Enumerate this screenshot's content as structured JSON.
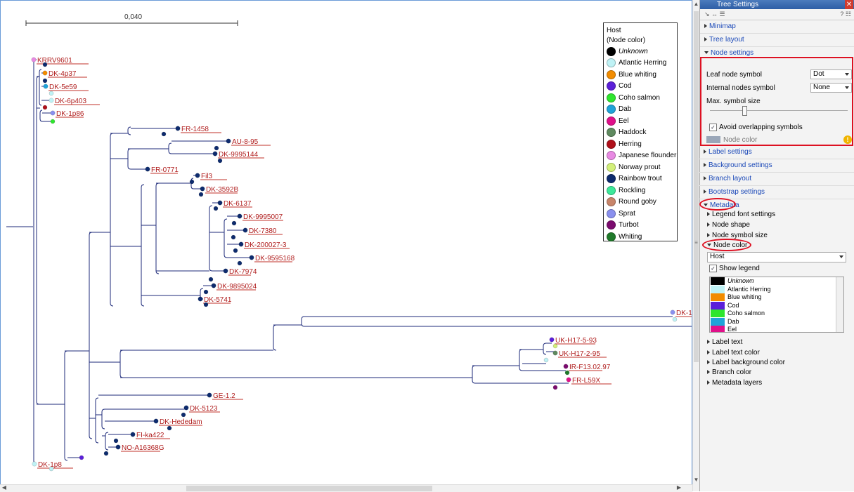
{
  "scale_bar": "0,040",
  "legend": {
    "title": "Host",
    "subtitle": "(Node color)",
    "items": [
      {
        "label": "Unknown",
        "color": "#000000",
        "italic": true
      },
      {
        "label": "Atlantic Herring",
        "color": "#bff2f5"
      },
      {
        "label": "Blue whiting",
        "color": "#f28c00"
      },
      {
        "label": "Cod",
        "color": "#5b1fd9"
      },
      {
        "label": "Coho salmon",
        "color": "#2ee62e"
      },
      {
        "label": "Dab",
        "color": "#1fa3d9"
      },
      {
        "label": "Eel",
        "color": "#e0108a"
      },
      {
        "label": "Haddock",
        "color": "#5f8a5f"
      },
      {
        "label": "Herring",
        "color": "#b0101a"
      },
      {
        "label": "Japanese flounder",
        "color": "#e88ae3"
      },
      {
        "label": "Norway prout",
        "color": "#d3f07a"
      },
      {
        "label": "Rainbow trout",
        "color": "#0d2b6e"
      },
      {
        "label": "Rockling",
        "color": "#3de89a"
      },
      {
        "label": "Round goby",
        "color": "#c8856a"
      },
      {
        "label": "Sprat",
        "color": "#8a90ee"
      },
      {
        "label": "Turbot",
        "color": "#7b0b6e"
      },
      {
        "label": "Whiting",
        "color": "#1f7a2a"
      }
    ]
  },
  "leaves": [
    {
      "label": "KRRV9601",
      "color": "#e88ae3"
    },
    {
      "label": "DK-4p37",
      "color": "#f28c00"
    },
    {
      "label": "DK-5e59",
      "color": "#1fa3d9"
    },
    {
      "label": "DK-6p403",
      "color": "#bff2f5"
    },
    {
      "label": "DK-1p86",
      "color": "#8a90ee"
    },
    {
      "label": "FR-1458",
      "color": "#0d2b6e"
    },
    {
      "label": "AU-8-95",
      "color": "#0d2b6e"
    },
    {
      "label": "DK-9995144",
      "color": "#0d2b6e"
    },
    {
      "label": "FR-0771",
      "color": "#0d2b6e"
    },
    {
      "label": "Fil3",
      "color": "#0d2b6e"
    },
    {
      "label": "DK-3592B",
      "color": "#0d2b6e"
    },
    {
      "label": "DK-6137",
      "color": "#0d2b6e"
    },
    {
      "label": "DK-9995007",
      "color": "#0d2b6e"
    },
    {
      "label": "DK-7380",
      "color": "#0d2b6e"
    },
    {
      "label": "DK-200027-3",
      "color": "#0d2b6e"
    },
    {
      "label": "DK-9595168",
      "color": "#0d2b6e"
    },
    {
      "label": "DK-7974",
      "color": "#0d2b6e"
    },
    {
      "label": "DK-9895024",
      "color": "#0d2b6e"
    },
    {
      "label": "DK-5741",
      "color": "#0d2b6e"
    },
    {
      "label": "DK-1",
      "color": "#8a90ee"
    },
    {
      "label": "UK-H17-5-93",
      "color": "#5b1fd9"
    },
    {
      "label": "UK-H17-2-95",
      "color": "#5f8a5f"
    },
    {
      "label": "IR-F13.02.97",
      "color": "#7b0b6e"
    },
    {
      "label": "FR-L59X",
      "color": "#e0108a"
    },
    {
      "label": "GE-1.2",
      "color": "#0d2b6e"
    },
    {
      "label": "DK-5123",
      "color": "#0d2b6e"
    },
    {
      "label": "DK-Hededam",
      "color": "#0d2b6e"
    },
    {
      "label": "FI-ka422",
      "color": "#0d2b6e"
    },
    {
      "label": "NO-A16368G",
      "color": "#0d2b6e"
    },
    {
      "label": "DK-1p8",
      "color": "#bff2f5"
    }
  ],
  "panel": {
    "title": "Tree Settings",
    "toolbar_right": "?",
    "sections": {
      "minimap": "Minimap",
      "tree_layout": "Tree layout",
      "node_settings": "Node settings",
      "label_settings": "Label settings",
      "background_settings": "Background settings",
      "branch_layout": "Branch layout",
      "bootstrap_settings": "Bootstrap settings",
      "metadata": "Metadata"
    },
    "node_settings": {
      "leaf_label": "Leaf node symbol",
      "leaf_value": "Dot",
      "internal_label": "Internal nodes symbol",
      "internal_value": "None",
      "max_size_label": "Max. symbol size",
      "avoid_overlap": "Avoid overlapping symbols",
      "node_color": "Node color"
    },
    "metadata": {
      "legend_font": "Legend font settings",
      "node_shape": "Node shape",
      "node_symbol_size": "Node symbol size",
      "node_color": "Node color",
      "host_value": "Host",
      "show_legend": "Show legend",
      "label_text": "Label text",
      "label_text_color": "Label text color",
      "label_background_color": "Label background color",
      "branch_color": "Branch color",
      "metadata_layers": "Metadata layers"
    },
    "color_list": [
      {
        "label": "Unknown",
        "color": "#000000",
        "italic": true
      },
      {
        "label": "Atlantic Herring",
        "color": "#bff2f5"
      },
      {
        "label": "Blue whiting",
        "color": "#f28c00"
      },
      {
        "label": "Cod",
        "color": "#5b1fd9"
      },
      {
        "label": "Coho salmon",
        "color": "#2ee62e"
      },
      {
        "label": "Dab",
        "color": "#1fa3d9"
      },
      {
        "label": "Eel",
        "color": "#e0108a"
      }
    ]
  }
}
